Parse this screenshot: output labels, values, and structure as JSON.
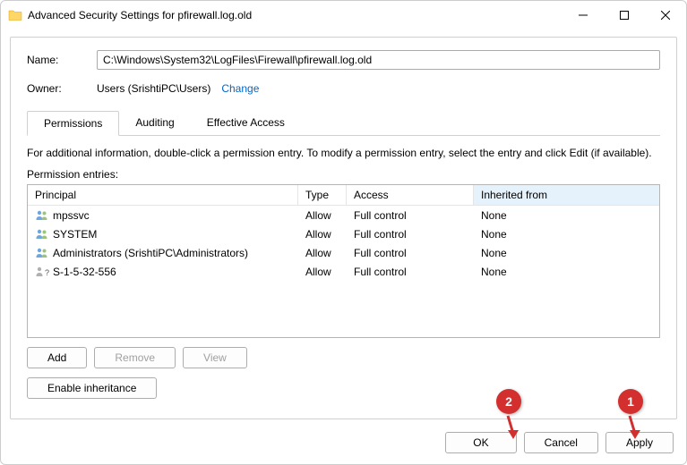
{
  "window": {
    "title": "Advanced Security Settings for pfirewall.log.old"
  },
  "fields": {
    "name_label": "Name:",
    "name_value": "C:\\Windows\\System32\\LogFiles\\Firewall\\pfirewall.log.old",
    "owner_label": "Owner:",
    "owner_value": "Users (SrishtiPC\\Users)",
    "change_link": "Change"
  },
  "tabs": {
    "permissions": "Permissions",
    "auditing": "Auditing",
    "effective": "Effective Access"
  },
  "info": "For additional information, double-click a permission entry. To modify a permission entry, select the entry and click Edit (if available).",
  "entries_label": "Permission entries:",
  "table": {
    "headers": {
      "principal": "Principal",
      "type": "Type",
      "access": "Access",
      "inherited": "Inherited from"
    },
    "rows": [
      {
        "icon": "users",
        "principal": "mpssvc",
        "type": "Allow",
        "access": "Full control",
        "inherited": "None"
      },
      {
        "icon": "users",
        "principal": "SYSTEM",
        "type": "Allow",
        "access": "Full control",
        "inherited": "None"
      },
      {
        "icon": "users",
        "principal": "Administrators (SrishtiPC\\Administrators)",
        "type": "Allow",
        "access": "Full control",
        "inherited": "None"
      },
      {
        "icon": "unknown",
        "principal": "S-1-5-32-556",
        "type": "Allow",
        "access": "Full control",
        "inherited": "None"
      }
    ]
  },
  "buttons": {
    "add": "Add",
    "remove": "Remove",
    "view": "View",
    "enable_inheritance": "Enable inheritance",
    "ok": "OK",
    "cancel": "Cancel",
    "apply": "Apply"
  },
  "callouts": {
    "one": "1",
    "two": "2"
  }
}
